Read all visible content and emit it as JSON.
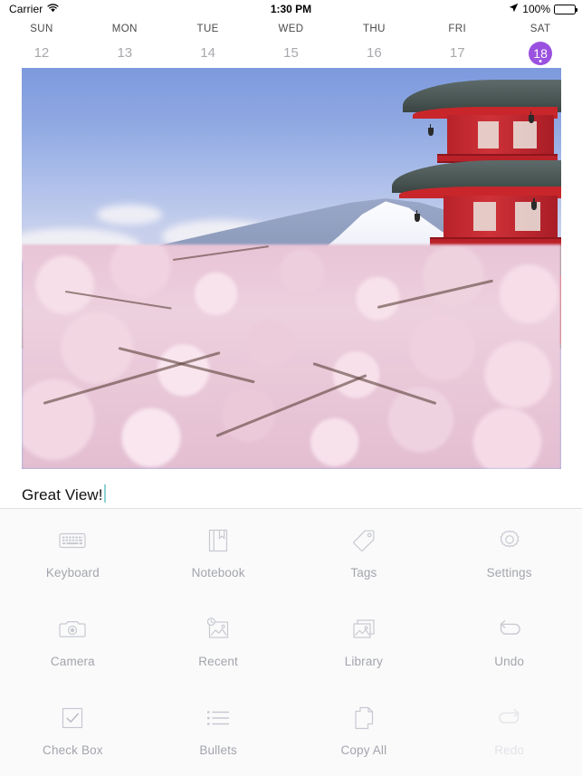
{
  "status_bar": {
    "carrier": "Carrier",
    "wifi_icon": "wifi-icon",
    "time": "1:30 PM",
    "location_icon": "location-arrow-icon",
    "battery_percent": "100%",
    "battery_icon": "battery-full-icon"
  },
  "week_strip": {
    "days": [
      {
        "name": "SUN",
        "number": "12",
        "selected": false
      },
      {
        "name": "MON",
        "number": "13",
        "selected": false
      },
      {
        "name": "TUE",
        "number": "14",
        "selected": false
      },
      {
        "name": "WED",
        "number": "15",
        "selected": false
      },
      {
        "name": "THU",
        "number": "16",
        "selected": false
      },
      {
        "name": "FRI",
        "number": "17",
        "selected": false
      },
      {
        "name": "SAT",
        "number": "18",
        "selected": true
      }
    ],
    "selected_accent": "#9b51e0"
  },
  "note": {
    "photo_alt": "Mount Fuji with red pagoda and cherry blossoms",
    "text": "Great View!",
    "caret_color": "#8fd3d3"
  },
  "toolbar": {
    "background": "#fafafa",
    "label_color": "#a3a5ad",
    "disabled_label_color": "#e3e4e8",
    "items": [
      {
        "label": "Keyboard",
        "icon": "keyboard-icon",
        "disabled": false
      },
      {
        "label": "Notebook",
        "icon": "notebook-icon",
        "disabled": false
      },
      {
        "label": "Tags",
        "icon": "tag-icon",
        "disabled": false
      },
      {
        "label": "Settings",
        "icon": "gear-icon",
        "disabled": false
      },
      {
        "label": "Camera",
        "icon": "camera-icon",
        "disabled": false
      },
      {
        "label": "Recent",
        "icon": "recent-photo-icon",
        "disabled": false
      },
      {
        "label": "Library",
        "icon": "photo-library-icon",
        "disabled": false
      },
      {
        "label": "Undo",
        "icon": "undo-arrow-icon",
        "disabled": false
      },
      {
        "label": "Check Box",
        "icon": "checkbox-icon",
        "disabled": false
      },
      {
        "label": "Bullets",
        "icon": "bullet-list-icon",
        "disabled": false
      },
      {
        "label": "Copy All",
        "icon": "copy-icon",
        "disabled": false
      },
      {
        "label": "Redo",
        "icon": "redo-arrow-icon",
        "disabled": true
      }
    ]
  }
}
